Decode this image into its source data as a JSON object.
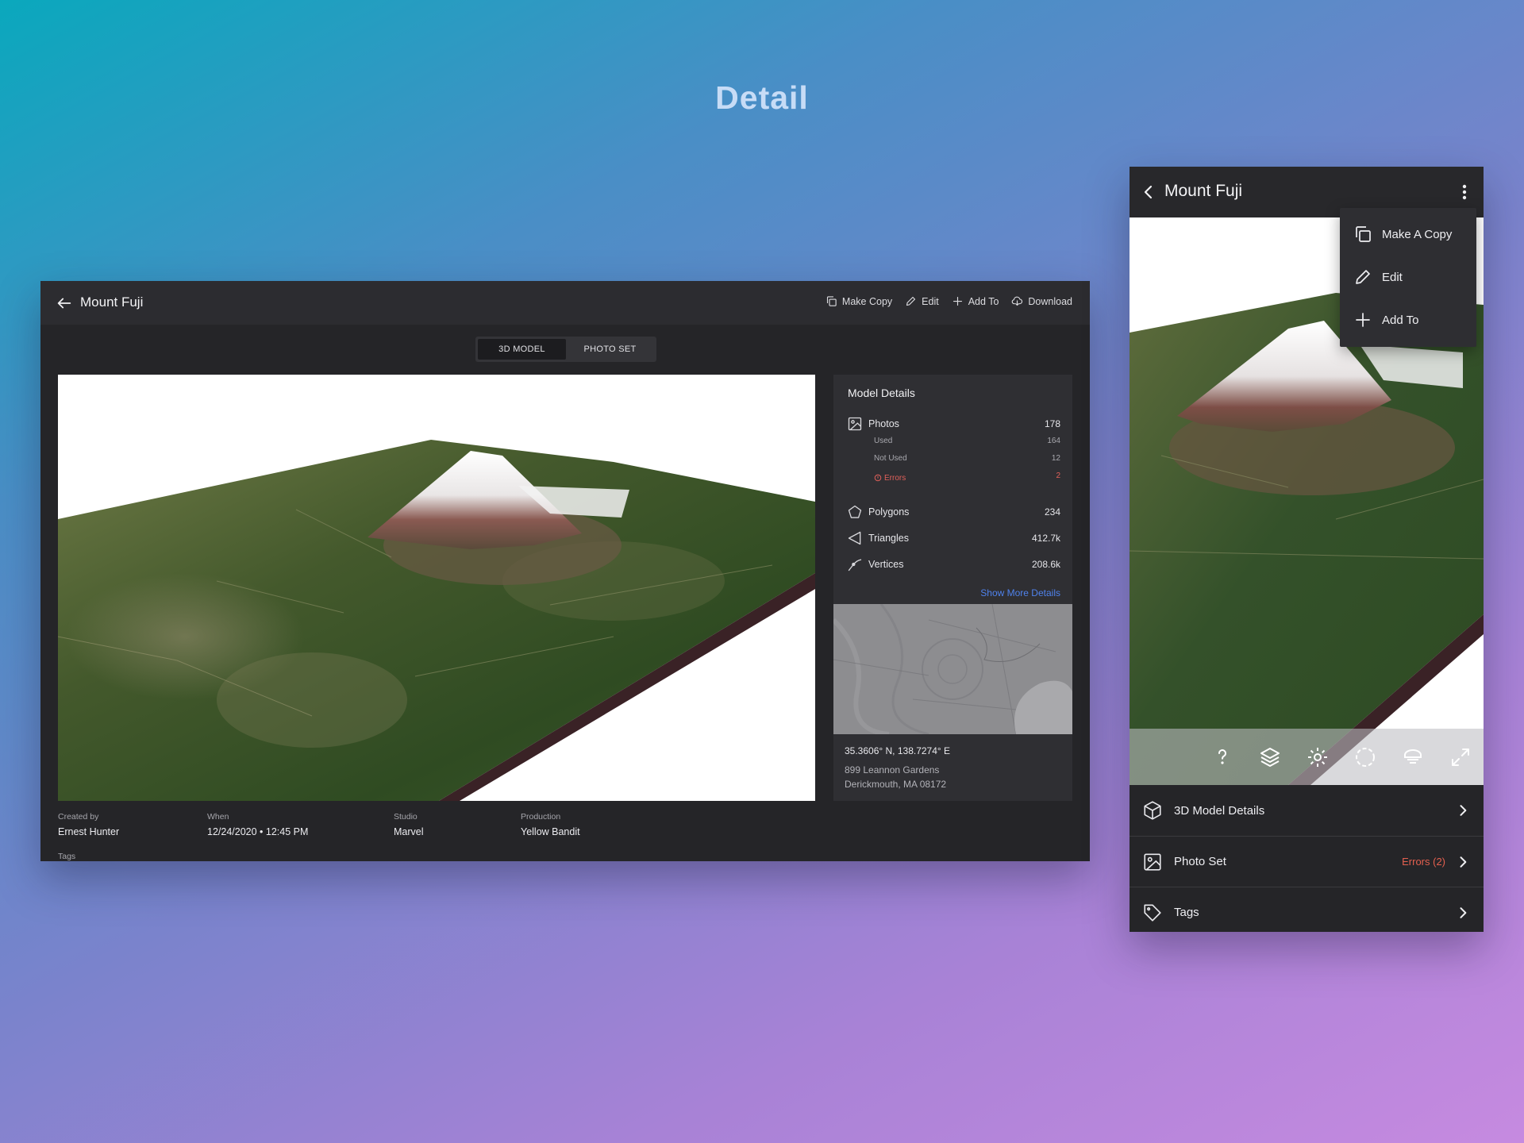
{
  "page": {
    "heading": "Detail"
  },
  "desktop": {
    "title": "Mount Fuji",
    "actions": [
      {
        "label": "Make Copy",
        "icon": "copy-icon"
      },
      {
        "label": "Edit",
        "icon": "pencil-icon"
      },
      {
        "label": "Add To",
        "icon": "plus-icon"
      },
      {
        "label": "Download",
        "icon": "cloud-download-icon"
      }
    ],
    "tabs": [
      {
        "label": "3D MODEL",
        "active": true
      },
      {
        "label": "PHOTO SET",
        "active": false
      }
    ],
    "panel": {
      "title": "Model Details",
      "photos": {
        "label": "Photos",
        "value": "178"
      },
      "used": {
        "label": "Used",
        "value": "164"
      },
      "not_used": {
        "label": "Not Used",
        "value": "12"
      },
      "errors": {
        "label": "Errors",
        "value": "2"
      },
      "polygons": {
        "label": "Polygons",
        "value": "234"
      },
      "triangles": {
        "label": "Triangles",
        "value": "412.7k"
      },
      "vertices": {
        "label": "Vertices",
        "value": "208.6k"
      },
      "show_more": "Show More Details",
      "location": {
        "coords": "35.3606° N, 138.7274° E",
        "address_line1": "899 Leannon Gardens",
        "address_line2": "Derickmouth, MA 08172"
      }
    },
    "meta": {
      "created_by": {
        "label": "Created by",
        "value": "Ernest Hunter"
      },
      "when": {
        "label": "When",
        "value": "12/24/2020 • 12:45 PM"
      },
      "studio": {
        "label": "Studio",
        "value": "Marvel"
      },
      "production": {
        "label": "Production",
        "value": "Yellow Bandit"
      },
      "tags_label": "Tags"
    }
  },
  "mobile": {
    "title": "Mount Fuji",
    "menu": [
      {
        "label": "Make A Copy",
        "icon": "copy-icon"
      },
      {
        "label": "Edit",
        "icon": "pencil-icon"
      },
      {
        "label": "Add To",
        "icon": "plus-icon"
      }
    ],
    "toolbar_icons": [
      "help-icon",
      "layers-icon",
      "settings-icon",
      "rotate-icon",
      "light-icon",
      "fullscreen-icon"
    ],
    "rows": [
      {
        "label": "3D Model Details",
        "icon": "cube-icon",
        "badge": ""
      },
      {
        "label": "Photo Set",
        "icon": "image-icon",
        "badge": "Errors (2)"
      },
      {
        "label": "Tags",
        "icon": "tag-icon",
        "badge": ""
      }
    ]
  },
  "colors": {
    "accent_link": "#4f82ec",
    "error": "#e0605a",
    "surface": "#252528",
    "panel": "#2f2f33"
  }
}
